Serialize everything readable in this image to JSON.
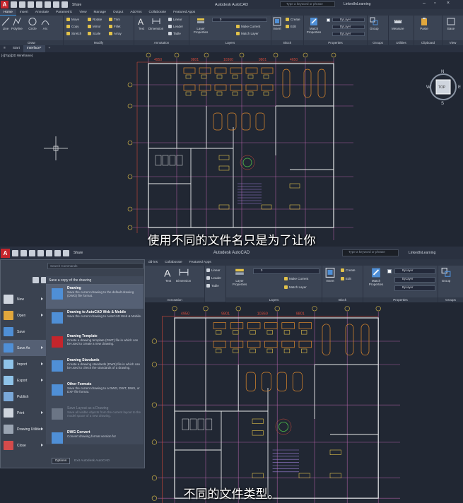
{
  "top": {
    "app_title": "Autodesk AutoCAD",
    "share_label": "Share",
    "search_placeholder": "Type a keyword or phrase",
    "user_label": "LinkedInLearning",
    "tabs": [
      "Home",
      "Insert",
      "Annotate",
      "Parametric",
      "View",
      "Manage",
      "Output",
      "Add-ins",
      "Collaborate",
      "Featured Apps"
    ],
    "draw": {
      "line": "Line",
      "polyline": "Polyline",
      "circle": "Circle",
      "arc": "Arc",
      "label": "Draw"
    },
    "modify": {
      "move": "Move",
      "copy": "Copy",
      "stretch": "Stretch",
      "rotate": "Rotate",
      "mirror": "Mirror",
      "scale": "Scale",
      "trim": "Trim",
      "fillet": "Fillet",
      "array": "Array",
      "label": "Modify"
    },
    "annotation": {
      "text": "Text",
      "dimension": "Dimension",
      "linear": "Linear",
      "leader": "Leader",
      "table": "Table",
      "label": "Annotation"
    },
    "layers": {
      "properties": "Layer Properties",
      "layer_value": "0",
      "make_current": "Make Current",
      "match_layer": "Match Layer",
      "label": "Layers"
    },
    "block": {
      "insert": "Insert",
      "create": "Create",
      "edit": "Edit",
      "label": "Block"
    },
    "properties": {
      "match": "Match Properties",
      "bylayer": "ByLayer",
      "label": "Properties"
    },
    "groups": {
      "group": "Group",
      "label": "Groups"
    },
    "utilities": {
      "measure": "Measure",
      "label": "Utilities"
    },
    "clipboard": {
      "paste": "Paste",
      "label": "Clipboard"
    },
    "view": {
      "base": "Base",
      "label": "View"
    },
    "doctabs": [
      "Start",
      "Interface*"
    ],
    "viewport_label": "[-][Top][2D Wireframe]",
    "dims": [
      "4950",
      "9801",
      "10360",
      "9801",
      "4650"
    ],
    "viewcube": {
      "top": "TOP",
      "n": "N",
      "s": "S",
      "e": "E",
      "w": "W"
    },
    "subtitle": "使用不同的文件名只是为了让你"
  },
  "bottom": {
    "app_title": "Autodesk AutoCAD",
    "share_label": "Share",
    "search_placeholder": "Type a keyword or phrase",
    "user_label": "LinkedInLearning",
    "tabs": [
      "dd-ins",
      "Collaborate",
      "Featured Apps"
    ],
    "annotation": {
      "text": "Text",
      "dimension": "Dimension",
      "linear": "Linear",
      "leader": "Leader",
      "table": "Table",
      "label": "Annotation"
    },
    "layers": {
      "properties": "Layer Properties",
      "layer_value": "0",
      "make_current": "Make Current",
      "match_layer": "Match Layer",
      "label": "Layers"
    },
    "block": {
      "insert": "Insert",
      "create": "Create",
      "edit": "Edit",
      "label": "Block"
    },
    "properties": {
      "match": "Match Properties",
      "bylayer": "ByLayer",
      "label": "Properties"
    },
    "groups": {
      "group": "Group",
      "label": "Groups"
    },
    "dims": [
      "4950",
      "9801",
      "10360",
      "9801"
    ],
    "subtitle": "不同的文件类型。",
    "menu": {
      "search_placeholder": "Search Commands",
      "items": [
        {
          "label": "New",
          "color": "#cfd5de",
          "arrow": true
        },
        {
          "label": "Open",
          "color": "#e1a73c",
          "arrow": true
        },
        {
          "label": "Save",
          "color": "#4f8fd6",
          "arrow": false
        },
        {
          "label": "Save As",
          "color": "#4f8fd6",
          "arrow": true
        },
        {
          "label": "Import",
          "color": "#8fc3e8",
          "arrow": true
        },
        {
          "label": "Export",
          "color": "#8fc3e8",
          "arrow": true
        },
        {
          "label": "Publish",
          "color": "#7aa8d8",
          "arrow": false
        },
        {
          "label": "Print",
          "color": "#cfd5de",
          "arrow": true
        },
        {
          "label": "Drawing Utilities",
          "color": "#9aa4b2",
          "arrow": true
        },
        {
          "label": "Close",
          "color": "#d44b4b",
          "arrow": true
        }
      ],
      "heading": "Save a copy of the drawing",
      "entries": [
        {
          "title": "Drawing",
          "desc": "Save the current drawing to the default drawing (DWG) file format.",
          "dim": false
        },
        {
          "title": "Drawing to AutoCAD Web & Mobile",
          "desc": "Save the current drawing to AutoCAD Web & Mobile.",
          "dim": false
        },
        {
          "title": "Drawing Template",
          "desc": "Create a drawing template (DWT) file in which can be used to create a new drawing.",
          "dim": false
        },
        {
          "title": "Drawing Standards",
          "desc": "Create a drawing standards (DWS) file in which can be used to check the standards of a drawing.",
          "dim": false
        },
        {
          "title": "Other Formats",
          "desc": "Save the current drawing to a DWG, DWT, DWS, or DXF file format.",
          "dim": false
        },
        {
          "title": "Save Layout as a Drawing",
          "desc": "Save all visible objects from the current layout to the model space of a new drawing.",
          "dim": true
        },
        {
          "title": "DWG Convert",
          "desc": "Convert drawing format version for",
          "dim": false
        }
      ],
      "options": "Options",
      "exit": "Exit Autodesk AutoCAD"
    }
  },
  "colors": {
    "yellow": "#e2c24a",
    "orange": "#e08a2c",
    "red": "#d44a3a",
    "white": "#e6e8ea",
    "purple": "#9a7fd6",
    "green": "#4ec24a",
    "grid": "#c66bb8"
  }
}
